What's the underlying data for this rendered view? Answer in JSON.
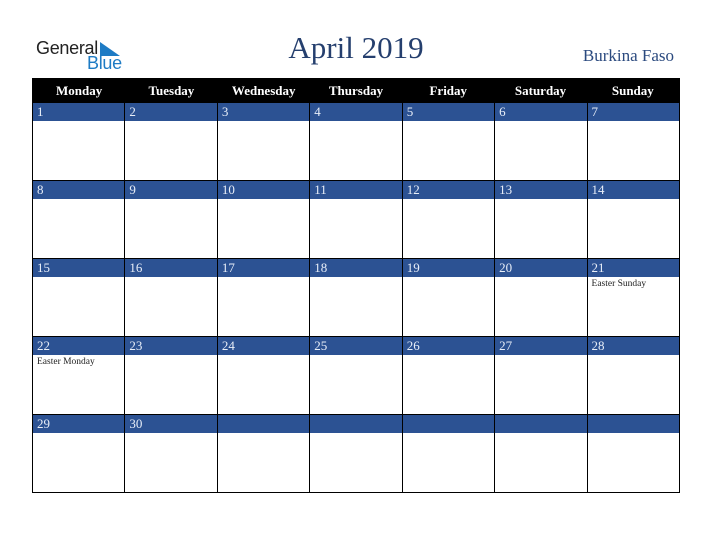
{
  "logo": {
    "line1": "General",
    "line2": "Blue"
  },
  "title": "April 2019",
  "country": "Burkina Faso",
  "weekdays": [
    "Monday",
    "Tuesday",
    "Wednesday",
    "Thursday",
    "Friday",
    "Saturday",
    "Sunday"
  ],
  "weeks": [
    {
      "days": [
        {
          "num": "1",
          "event": ""
        },
        {
          "num": "2",
          "event": ""
        },
        {
          "num": "3",
          "event": ""
        },
        {
          "num": "4",
          "event": ""
        },
        {
          "num": "5",
          "event": ""
        },
        {
          "num": "6",
          "event": ""
        },
        {
          "num": "7",
          "event": ""
        }
      ]
    },
    {
      "days": [
        {
          "num": "8",
          "event": ""
        },
        {
          "num": "9",
          "event": ""
        },
        {
          "num": "10",
          "event": ""
        },
        {
          "num": "11",
          "event": ""
        },
        {
          "num": "12",
          "event": ""
        },
        {
          "num": "13",
          "event": ""
        },
        {
          "num": "14",
          "event": ""
        }
      ]
    },
    {
      "days": [
        {
          "num": "15",
          "event": ""
        },
        {
          "num": "16",
          "event": ""
        },
        {
          "num": "17",
          "event": ""
        },
        {
          "num": "18",
          "event": ""
        },
        {
          "num": "19",
          "event": ""
        },
        {
          "num": "20",
          "event": ""
        },
        {
          "num": "21",
          "event": "Easter Sunday"
        }
      ]
    },
    {
      "days": [
        {
          "num": "22",
          "event": "Easter Monday"
        },
        {
          "num": "23",
          "event": ""
        },
        {
          "num": "24",
          "event": ""
        },
        {
          "num": "25",
          "event": ""
        },
        {
          "num": "26",
          "event": ""
        },
        {
          "num": "27",
          "event": ""
        },
        {
          "num": "28",
          "event": ""
        }
      ]
    },
    {
      "days": [
        {
          "num": "29",
          "event": ""
        },
        {
          "num": "30",
          "event": ""
        },
        {
          "num": "",
          "event": ""
        },
        {
          "num": "",
          "event": ""
        },
        {
          "num": "",
          "event": ""
        },
        {
          "num": "",
          "event": ""
        },
        {
          "num": "",
          "event": ""
        }
      ]
    }
  ]
}
